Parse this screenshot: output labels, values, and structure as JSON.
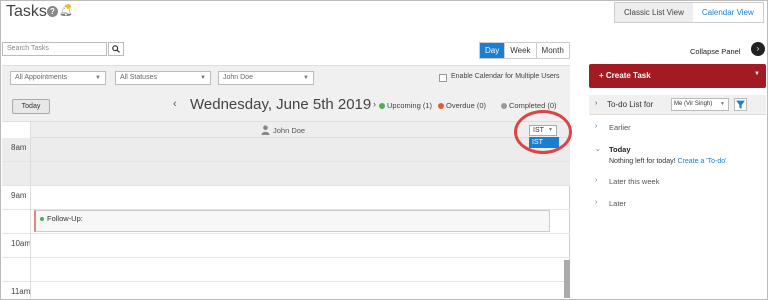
{
  "header": {
    "title": "Tasks",
    "views": [
      "Classic List View",
      "Calendar View"
    ]
  },
  "search": {
    "placeholder": "Search Tasks"
  },
  "range": [
    "Day",
    "Week",
    "Month"
  ],
  "filters": {
    "appointments": "All Appointments",
    "statuses": "All Statuses",
    "user": "John Doe",
    "multi_users_label": "Enable Calendar for Multiple Users"
  },
  "datebar": {
    "today_label": "Today",
    "date": "Wednesday, June 5th 2019",
    "legend": [
      {
        "label": "Upcoming (1)",
        "color": "#4caf50"
      },
      {
        "label": "Overdue (0)",
        "color": "#e05a3a"
      },
      {
        "label": "Completed (0)",
        "color": "#999999"
      }
    ]
  },
  "calendar": {
    "user": "John Doe",
    "timezone": "IST",
    "timezone_options": [
      "IST"
    ],
    "hours": [
      "8am",
      "9am",
      "10am",
      "11am"
    ],
    "event": "Follow-Up:"
  },
  "panel": {
    "collapse_label": "Collapse Panel",
    "create_task": "Create Task",
    "todo_title": "To-do List for",
    "todo_user": "Me (Vir Singh)",
    "groups": [
      "Earlier",
      "Today",
      "Later this week",
      "Later"
    ],
    "today_empty": "Nothing left for today!",
    "create_todo_link": "Create a 'To-do'"
  },
  "colors": {
    "accent": "#1a7fd0",
    "create_task": "#a31a23",
    "highlight": "#dd4444"
  }
}
